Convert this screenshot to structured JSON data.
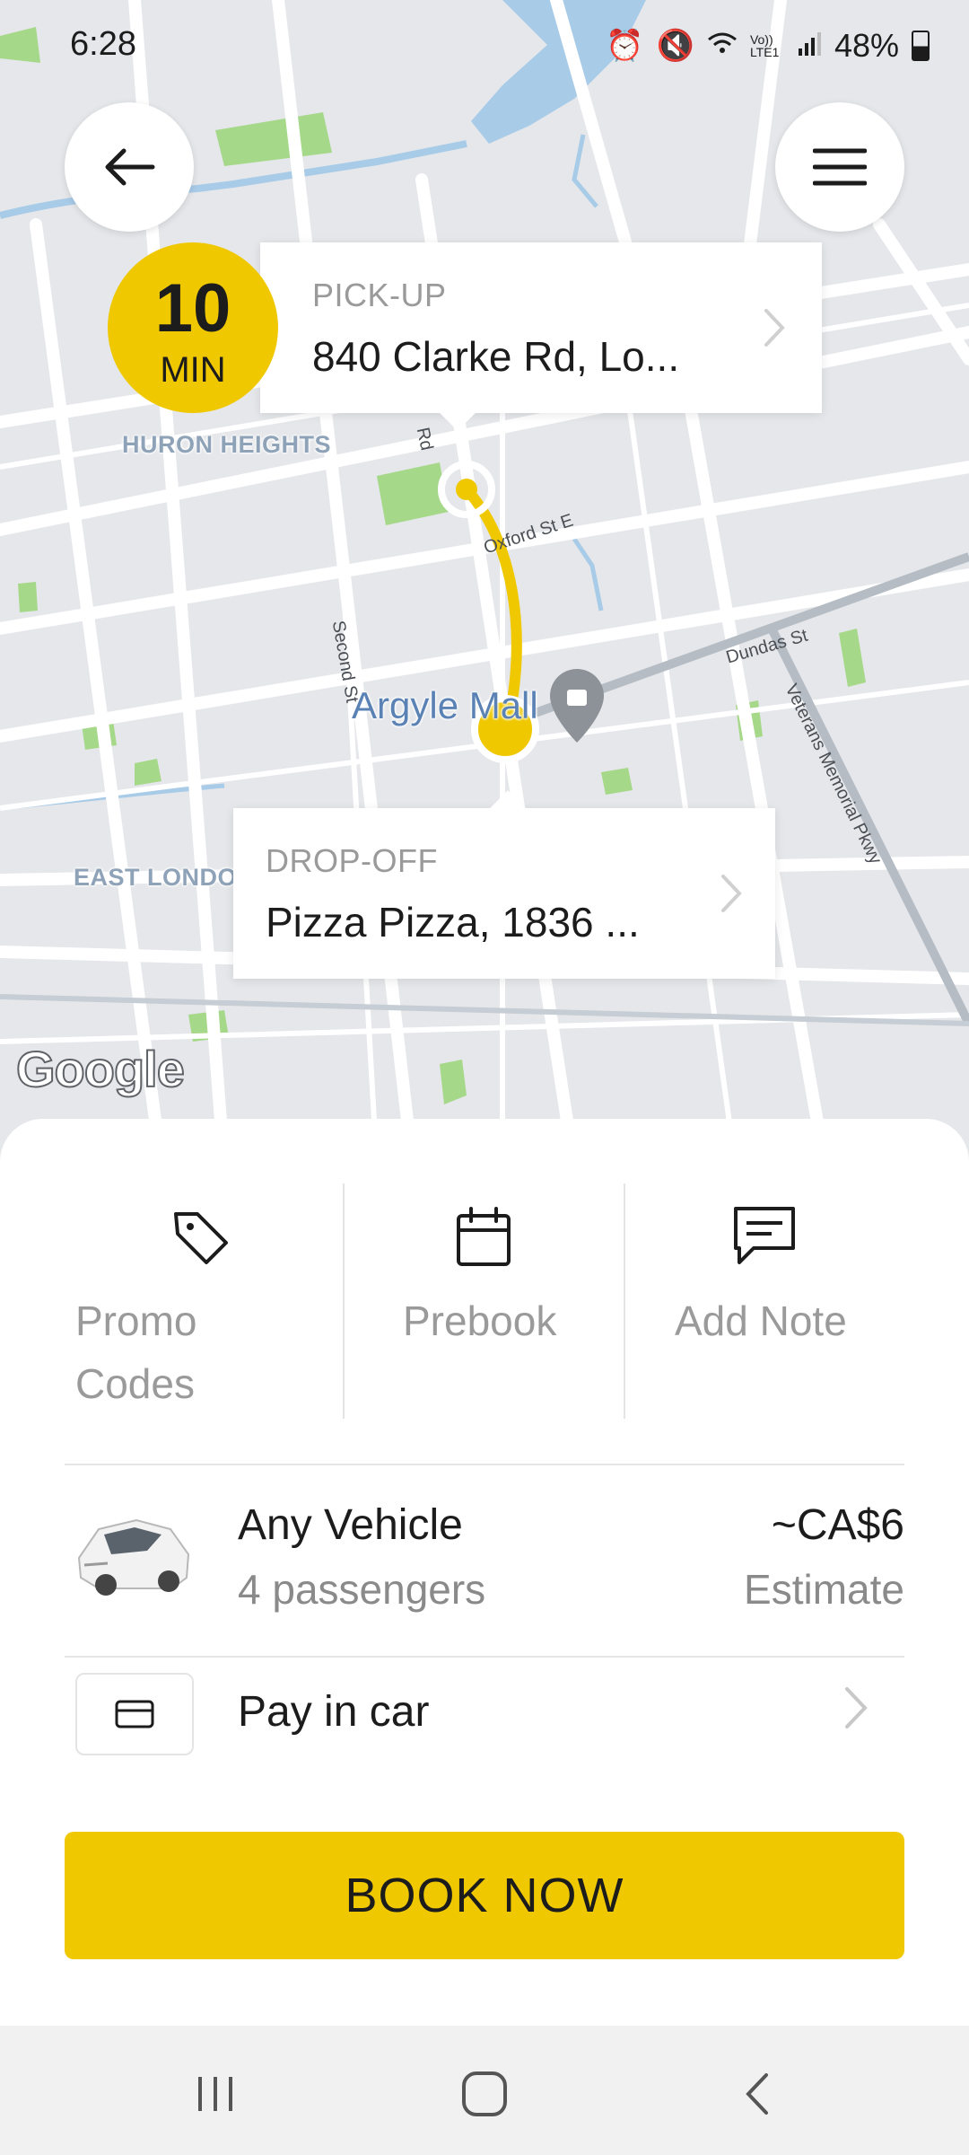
{
  "status_bar": {
    "time": "6:28",
    "battery_percent": "48%",
    "battery_level": 0.48,
    "icons": [
      "alarm-icon",
      "mute-icon",
      "wifi-icon",
      "volte-icon",
      "signal-icon",
      "battery-icon"
    ],
    "network_label": "Vo)) LTE1"
  },
  "map": {
    "area_labels": {
      "huron_heights": "HURON HEIGHTS",
      "east_london": "EAST LONDO"
    },
    "poi": {
      "argyle_mall": "Argyle Mall"
    },
    "streets": {
      "rd": "Rd",
      "oxford": "Oxford St E",
      "second": "Second St",
      "dundas": "Dundas St",
      "veterans": "Veterans Memorial Pkwy"
    },
    "attribution": "Google",
    "colors": {
      "route": "#efc800",
      "water": "#a8cbe8",
      "park": "#a6d88a",
      "road": "#ffffff",
      "land": "#e5e7ea"
    }
  },
  "eta": {
    "number": "10",
    "unit": "MIN"
  },
  "pickup": {
    "caption": "PICK-UP",
    "address": "840 Clarke Rd, Lo..."
  },
  "dropoff": {
    "caption": "DROP-OFF",
    "address": "Pizza Pizza, 1836 ..."
  },
  "options": {
    "promo_line1": "Promo",
    "promo_line2": "Codes",
    "prebook": "Prebook",
    "note": "Add Note"
  },
  "vehicle": {
    "name": "Any Vehicle",
    "capacity": "4 passengers",
    "price": "~CA$6",
    "price_note": "Estimate"
  },
  "payment": {
    "label": "Pay in car"
  },
  "book_button": {
    "label": "BOOK NOW",
    "color": "#efc800"
  }
}
